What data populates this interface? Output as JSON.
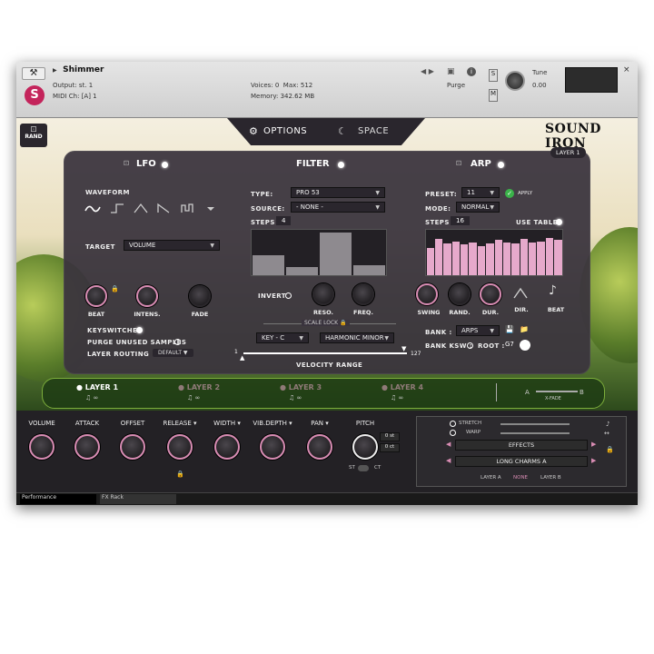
{
  "header": {
    "title": "Shimmer",
    "output_label": "Output:",
    "output_value": "st. 1",
    "midi_label": "MIDI Ch:",
    "midi_value": "[A] 1",
    "voices_label": "Voices:",
    "voices_value": "0",
    "max_label": "Max:",
    "max_value": "512",
    "memory_label": "Memory:",
    "memory_value": "342.62 MB",
    "purge_label": "Purge",
    "tune_label": "Tune",
    "tune_value": "0.00",
    "s_btn": "S",
    "m_btn": "M",
    "close": "×"
  },
  "tabs": {
    "rand": "RAND",
    "options": "OPTIONS",
    "space": "SPACE",
    "brand": "SOUND IRON",
    "layer_badge": "LAYER 1"
  },
  "lfo": {
    "title": "LFO",
    "waveform_label": "WAVEFORM",
    "target_label": "TARGET",
    "target_value": "VOLUME",
    "beat": "BEAT",
    "intens": "INTENS.",
    "fade": "FADE",
    "keyswitches": "KEYSWITCHES",
    "purge_unused": "PURGE UNUSED SAMPLES",
    "layer_routing": "LAYER ROUTING",
    "layer_routing_value": "DEFAULT"
  },
  "filter": {
    "title": "FILTER",
    "type_label": "TYPE:",
    "type_value": "PRO 53",
    "source_label": "SOURCE:",
    "source_value": "- NONE -",
    "steps_label": "STEPS",
    "steps_value": "4",
    "invert": "INVERT",
    "reso": "RESO.",
    "freq": "FREQ.",
    "scale_lock": "SCALE LOCK",
    "key_value": "KEY - C",
    "scale_value": "HARMONIC MINOR",
    "vel_min": "1",
    "vel_max": "127",
    "velocity_range": "VELOCITY RANGE"
  },
  "arp": {
    "title": "ARP",
    "preset_label": "PRESET:",
    "preset_value": "11",
    "apply": "APPLY",
    "mode_label": "MODE:",
    "mode_value": "NORMAL",
    "steps_label": "STEPS",
    "steps_value": "16",
    "use_table": "USE TABLE",
    "swing": "SWING",
    "rand": "RAND.",
    "dur": "DUR.",
    "dir": "DIR.",
    "beat": "BEAT",
    "bank_label": "BANK :",
    "bank_value": "ARPS",
    "bank_ksw": "BANK KSW :",
    "root_label": "ROOT :",
    "root_value": "G7"
  },
  "layers": [
    {
      "name": "LAYER 1"
    },
    {
      "name": "LAYER 2"
    },
    {
      "name": "LAYER 3"
    },
    {
      "name": "LAYER 4"
    }
  ],
  "xfade": {
    "a": "A",
    "b": "B",
    "label": "X-FADE"
  },
  "bottom": {
    "volume": "VOLUME",
    "attack": "ATTACK",
    "offset": "OFFSET",
    "release": "RELEASE",
    "width": "WIDTH",
    "vib_depth": "VIB.DEPTH",
    "pan": "PAN",
    "pitch": "PITCH",
    "pitch_st": "0 st",
    "pitch_ct": "0 ct",
    "st": "ST",
    "ct": "CT"
  },
  "fx": {
    "stretch": "STRETCH",
    "warp": "WARP",
    "effects": "EFFECTS",
    "preset": "LONG CHARMS A",
    "layer_a": "LAYER A",
    "none": "NONE",
    "layer_b": "LAYER B"
  },
  "status": {
    "tab1": "Performance",
    "tab2": "FX Rack"
  },
  "filter_steps": [
    0.45,
    0.18,
    0.95,
    0.22
  ],
  "arp_steps": [
    0.6,
    0.8,
    0.7,
    0.75,
    0.68,
    0.72,
    0.65,
    0.7,
    0.78,
    0.72,
    0.7,
    0.8,
    0.72,
    0.75,
    0.82,
    0.78
  ],
  "colors": {
    "accent": "#d88cb3",
    "panel": "#3a343e"
  }
}
